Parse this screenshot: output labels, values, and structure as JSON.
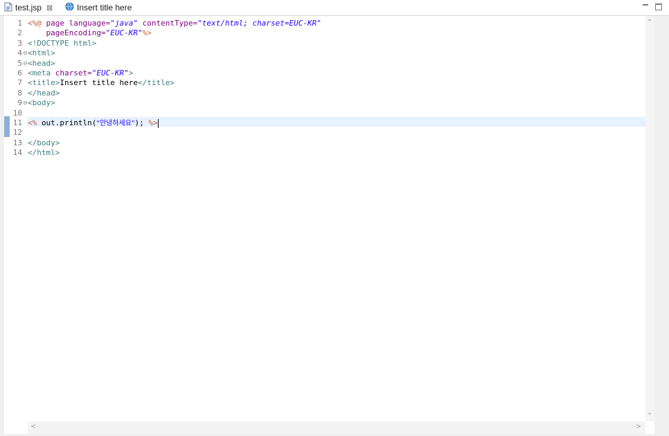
{
  "tabs": [
    {
      "label": "test.jsp",
      "icon": "jsp-file-icon",
      "active": true
    },
    {
      "label": "Insert title here",
      "icon": "globe-icon",
      "active": false
    }
  ],
  "tab_close_glyph": "⊠",
  "editor": {
    "current_line": 11,
    "lines": [
      {
        "n": "1"
      },
      {
        "n": "2"
      },
      {
        "n": "3"
      },
      {
        "n": "4"
      },
      {
        "n": "5"
      },
      {
        "n": "6"
      },
      {
        "n": "7"
      },
      {
        "n": "8"
      },
      {
        "n": "9"
      },
      {
        "n": "10"
      },
      {
        "n": "11"
      },
      {
        "n": "12"
      },
      {
        "n": "13"
      },
      {
        "n": "14"
      }
    ],
    "code": {
      "l1": {
        "open": "<%@",
        "page": " page ",
        "lang_attr": "language=",
        "lang_val": "\"java\"",
        "ct_attr": " contentType=",
        "ct_val": "\"text/html; charset=EUC-KR\""
      },
      "l2": {
        "indent": "    ",
        "pe_attr": "pageEncoding=",
        "pe_val": "\"EUC-KR\"",
        "close": "%>"
      },
      "l3": {
        "text": "<!DOCTYPE html>"
      },
      "l4": {
        "text": "<html>"
      },
      "l5": {
        "text": "<head>"
      },
      "l6": {
        "open": "<meta",
        "attr": " charset=",
        "val": "\"EUC-KR\"",
        "close": ">"
      },
      "l7": {
        "open": "<title>",
        "text": "Insert title here",
        "close": "</title>"
      },
      "l8": {
        "text": "</head>"
      },
      "l9": {
        "text": "<body>"
      },
      "l11": {
        "open": "<%",
        "stmt": " out.println(",
        "str": "\"안녕하세요\"",
        "end": "); ",
        "close": "%>"
      },
      "l13": {
        "text": "</body>"
      },
      "l14": {
        "text": "</html>"
      }
    }
  },
  "colors": {
    "tag": "#3f7f7f",
    "attribute": "#7f007f",
    "value": "#2a00ff",
    "delimiter": "#bf5f3f",
    "current_line": "#e8f2fe"
  }
}
